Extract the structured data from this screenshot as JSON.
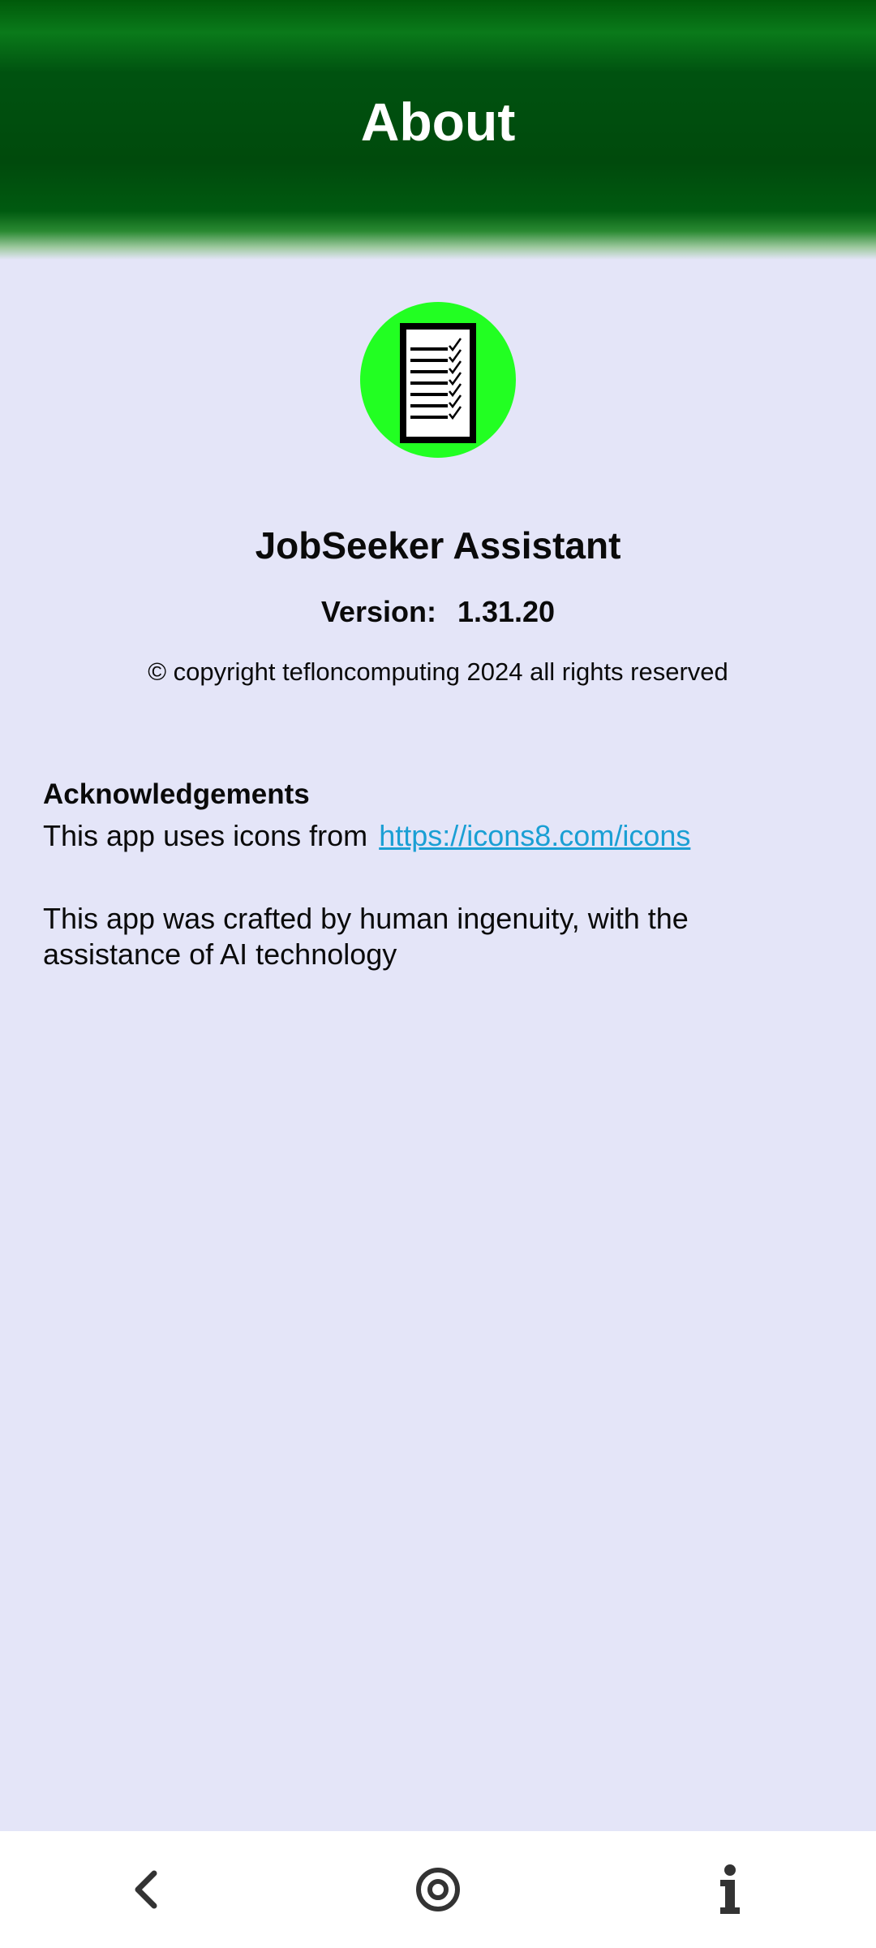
{
  "header": {
    "title": "About"
  },
  "app": {
    "logo_icon": "checklist-document-icon",
    "name": "JobSeeker Assistant",
    "version_label": "Version:",
    "version_value": "1.31.20",
    "copyright": "© copyright tefloncomputing 2024 all rights reserved"
  },
  "acknowledgements": {
    "heading": "Acknowledgements",
    "icons_text": "This app uses icons from",
    "icons_link": "https://icons8.com/icons",
    "crafted_text": "This app was crafted by human ingenuity, with the assistance of AI technology"
  },
  "navbar": {
    "back_icon": "back-chevron-icon",
    "home_icon": "home-circle-icon",
    "info_icon": "info-icon"
  },
  "colors": {
    "header_green": "#004a0c",
    "logo_green": "#22ff22",
    "background": "#e4e5f8",
    "link": "#1a9fd4"
  }
}
